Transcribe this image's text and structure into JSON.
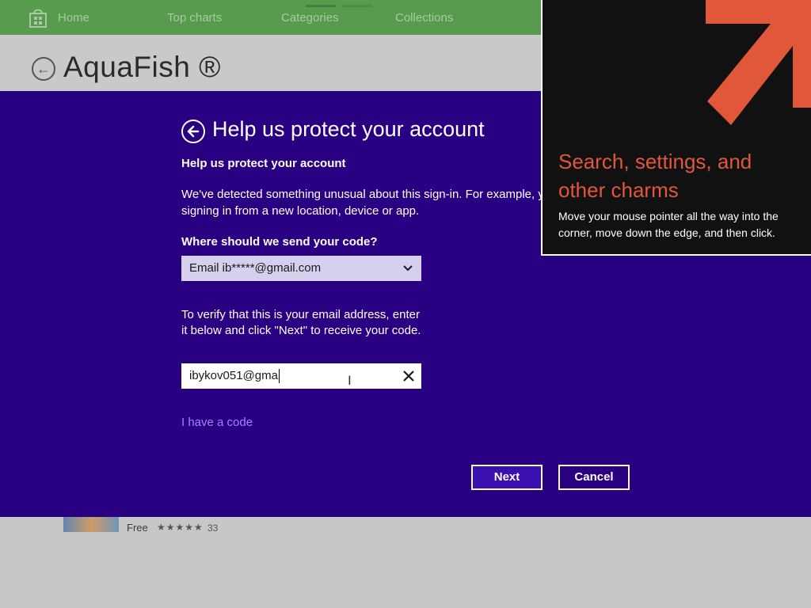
{
  "store": {
    "nav": [
      "Home",
      "Top charts",
      "Categories",
      "Collections"
    ],
    "app_title": "AquaFish ®",
    "app_listing": {
      "price": "Free",
      "stars": "★★★★★",
      "rating_count": "33"
    }
  },
  "dialog": {
    "title": "Help us protect your account",
    "subtitle": "Help us protect your account",
    "description_lines": [
      "We've detected something unusual about this sign-in. For example, y",
      "signing in from a new location, device or app."
    ],
    "where_label": "Where should we send your code?",
    "send_select_value": "Email ib*****@gmail.com",
    "verify_lines": [
      "To verify that this is your email address, enter",
      "it below and click \"Next\" to receive your code."
    ],
    "email_value": "ibykov051@gma",
    "have_code_link": "I have a code",
    "next_label": "Next",
    "cancel_label": "Cancel"
  },
  "charms_tip": {
    "title_lines": [
      "Search, settings, and",
      "other charms"
    ],
    "body_lines": [
      "Move your mouse pointer all the way into the",
      "corner, move down the edge, and then click."
    ]
  },
  "colors": {
    "dialog_bg": "#2a0082",
    "nav_green": "#2e8b20",
    "accent_orange": "#e1573a",
    "link_purple": "#9f86ff"
  },
  "icons": [
    "store-logo-icon",
    "back-arrow-icon",
    "chevron-down-icon",
    "clear-icon",
    "text-cursor-icon",
    "charms-arrow-icon"
  ]
}
